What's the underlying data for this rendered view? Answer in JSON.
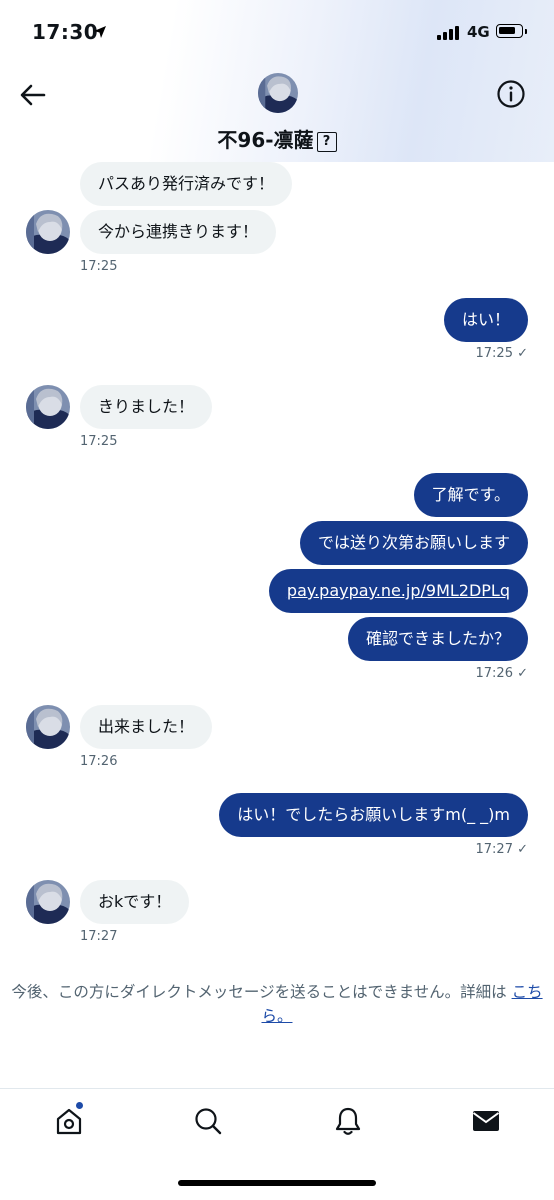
{
  "status_bar": {
    "time": "17:30",
    "network": "4G"
  },
  "header": {
    "title": "不96-凛薩",
    "unknown_glyph": "?"
  },
  "messages": {
    "m1": {
      "text": "パスあり発行済みです！"
    },
    "m2": {
      "text": "今から連携きります！",
      "time": "17:25"
    },
    "m3": {
      "text": "はい！",
      "time": "17:25 ✓"
    },
    "m4": {
      "text": "きりました！",
      "time": "17:25"
    },
    "m5": {
      "text": "了解です。"
    },
    "m6": {
      "text": "では送り次第お願いします"
    },
    "m7": {
      "text": "pay.paypay.ne.jp/9ML2DPLq"
    },
    "m8": {
      "text": "確認できましたか？",
      "time": "17:26 ✓"
    },
    "m9": {
      "text": "出来ました！",
      "time": "17:26"
    },
    "m10": {
      "text": "はい！でしたらお願いしますm(_ _)m",
      "time": "17:27 ✓"
    },
    "m11": {
      "text": "おkです！",
      "time": "17:27"
    }
  },
  "notice": {
    "text": "今後、この方にダイレクトメッセージを送ることはできません。詳細は ",
    "link": "こちら。"
  },
  "nav": {
    "items": [
      "home-icon",
      "search-icon",
      "bell-icon",
      "mail-icon"
    ]
  },
  "colors": {
    "outgoing": "#163a8c",
    "incoming": "#eff3f4",
    "accent": "#1d4ba8"
  }
}
